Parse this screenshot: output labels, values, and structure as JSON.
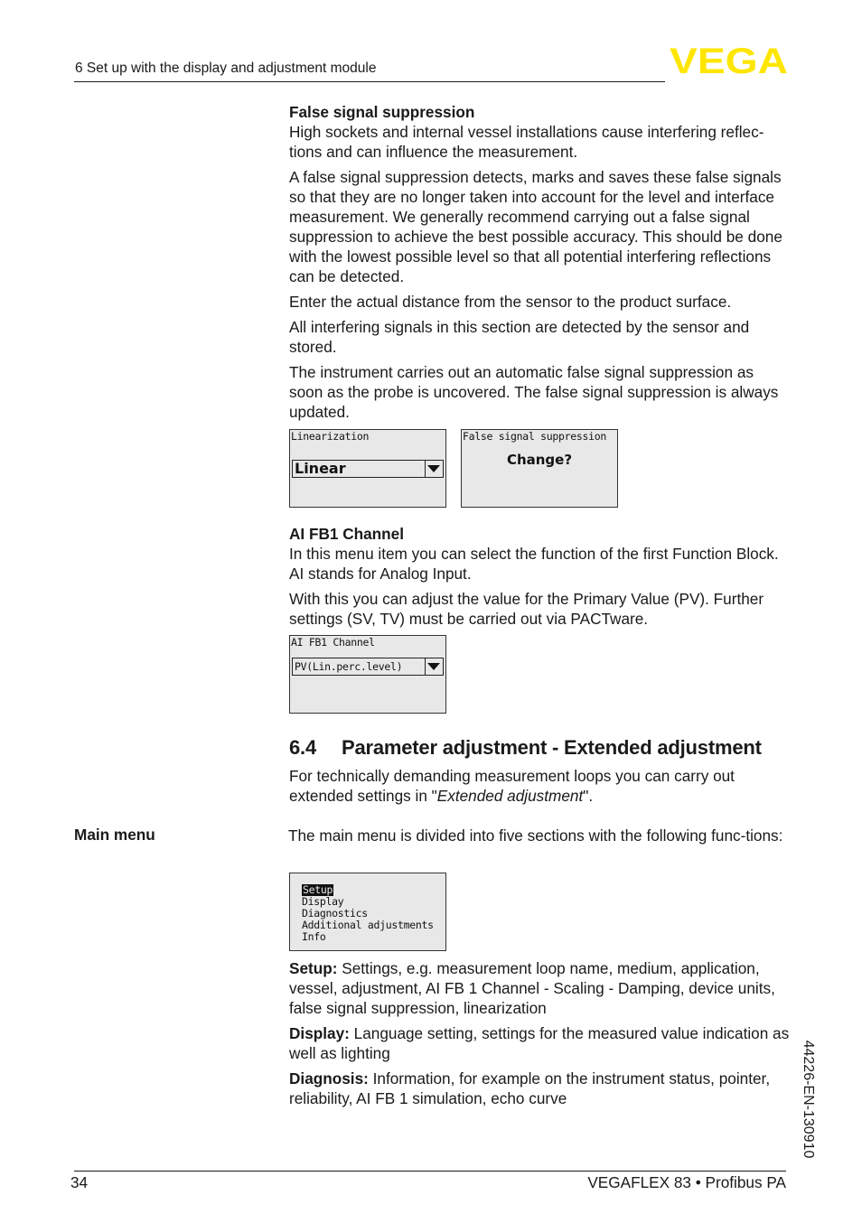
{
  "header": {
    "section_title": "6 Set up with the display and adjustment module",
    "logo_text": "VEGA",
    "logo_color": "#ffe600"
  },
  "false_signal": {
    "heading": "False signal suppression",
    "paragraphs": [
      "High sockets and internal vessel installations cause interfering reflec-tions and can influence the measurement.",
      "A false signal suppression detects, marks and saves these false signals so that they are no longer taken into account for the level and interface measurement. We generally recommend carrying out a false signal suppression to achieve the best possible accuracy. This should be done with the lowest possible level so that all potential interfering reflections can be detected.",
      "Enter the actual distance from the sensor to the product surface.",
      "All interfering signals in this section are detected by the sensor and stored.",
      "The instrument carries out an automatic false signal suppression as soon as the probe is uncovered. The false signal suppression is always updated."
    ]
  },
  "screens": {
    "linearization": {
      "title": "Linearization",
      "value": "Linear"
    },
    "false_signal": {
      "title": "False signal suppression",
      "prompt": "Change?"
    },
    "ai_fb1": {
      "title": "AI FB1 Channel",
      "value": "PV(Lin.perc.level)"
    },
    "main_menu": {
      "items": [
        "Setup",
        "Display",
        "Diagnostics",
        "Additional adjustments",
        "Info"
      ],
      "selected": "Setup"
    }
  },
  "ai_fb1": {
    "heading": "AI FB1 Channel",
    "paragraphs": [
      "In this menu item you can select the function of the first Function Block. AI stands for Analog Input.",
      "With this you can adjust the value for the Primary Value (PV). Further settings (SV, TV) must be carried out via PACTware."
    ]
  },
  "section_6_4": {
    "number": "6.4",
    "title": "Parameter adjustment - Extended adjustment",
    "intro_before": "For technically demanding measurement loops you can carry out extended settings in \"",
    "intro_italic": "Extended adjustment",
    "intro_after": "\"."
  },
  "main_menu": {
    "side_label": "Main menu",
    "intro": "The main menu is divided into five sections with the following func-tions:",
    "descriptions": [
      {
        "term": "Setup:",
        "text": " Settings, e.g. measurement loop name, medium, application, vessel, adjustment, AI FB 1 Channel - Scaling - Damping, device units, false signal suppression, linearization"
      },
      {
        "term": "Display:",
        "text": " Language setting, settings for the measured value indication as well as lighting"
      },
      {
        "term": "Diagnosis:",
        "text": " Information, for example on the instrument status, pointer, reliability, AI FB 1 simulation, echo curve"
      }
    ]
  },
  "footer": {
    "page_number": "34",
    "product": "VEGAFLEX 83 • Profibus PA",
    "doc_id": "44226-EN-130910"
  }
}
